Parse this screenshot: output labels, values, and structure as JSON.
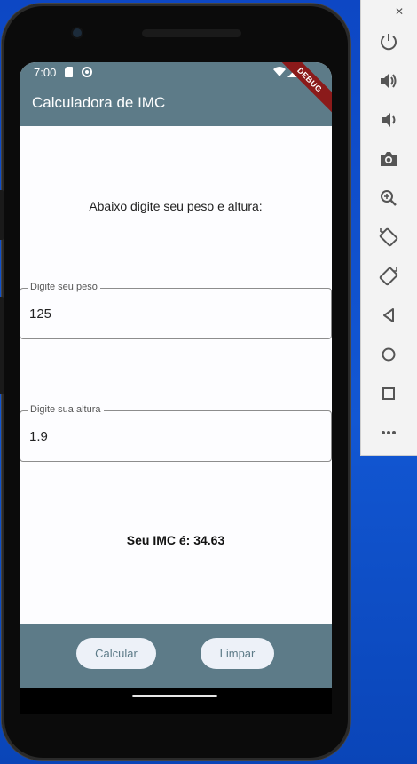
{
  "status_bar": {
    "time": "7:00"
  },
  "app_bar": {
    "title": "Calculadora de IMC",
    "debug_banner": "DEBUG"
  },
  "main": {
    "prompt": "Abaixo digite seu peso e altura:",
    "weight_field": {
      "label": "Digite seu peso",
      "value": "125"
    },
    "height_field": {
      "label": "Digite sua altura",
      "value": "1.9"
    },
    "result": "Seu IMC é: 34.63"
  },
  "actions": {
    "calculate_label": "Calcular",
    "clear_label": "Limpar"
  },
  "emulator_toolbar": {
    "window_controls": [
      "minimize-icon",
      "close-icon"
    ],
    "items": [
      "power-icon",
      "volume-up-icon",
      "volume-down-icon",
      "camera-icon",
      "zoom-icon",
      "rotate-left-icon",
      "rotate-right-icon",
      "back-icon",
      "home-icon",
      "overview-icon",
      "more-icon"
    ]
  },
  "colors": {
    "app_bar": "#5d7b88",
    "background": "#fdfdff",
    "desktop": "#1257d3",
    "button_bg": "#edf1f8"
  }
}
